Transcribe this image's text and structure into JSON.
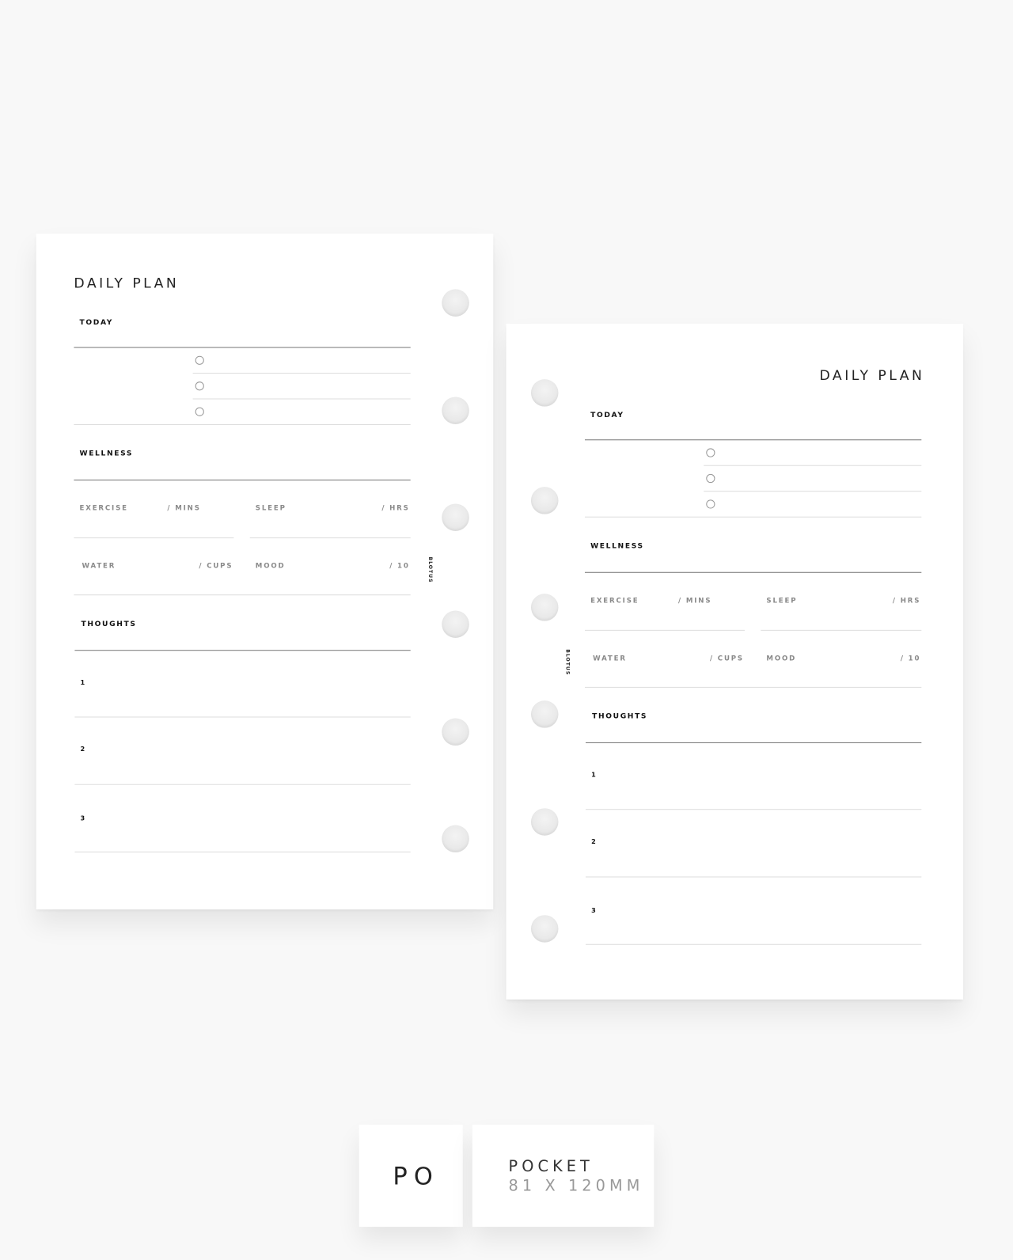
{
  "planner": {
    "title": "DAILY PLAN",
    "today_label": "TODAY",
    "wellness_label": "WELLNESS",
    "wellness_fields": [
      {
        "label": "EXERCISE",
        "unit": "/ MINS"
      },
      {
        "label": "SLEEP",
        "unit": "/ HRS"
      },
      {
        "label": "WATER",
        "unit": "/ CUPS"
      },
      {
        "label": "MOOD",
        "unit": "/ 10"
      }
    ],
    "thoughts_label": "THOUGHTS",
    "thoughts_numbers": [
      "1",
      "2",
      "3"
    ],
    "brand": "BLOTUS"
  },
  "size_badge": {
    "code": "PO",
    "name": "POCKET",
    "dimensions": "81 X 120MM"
  }
}
